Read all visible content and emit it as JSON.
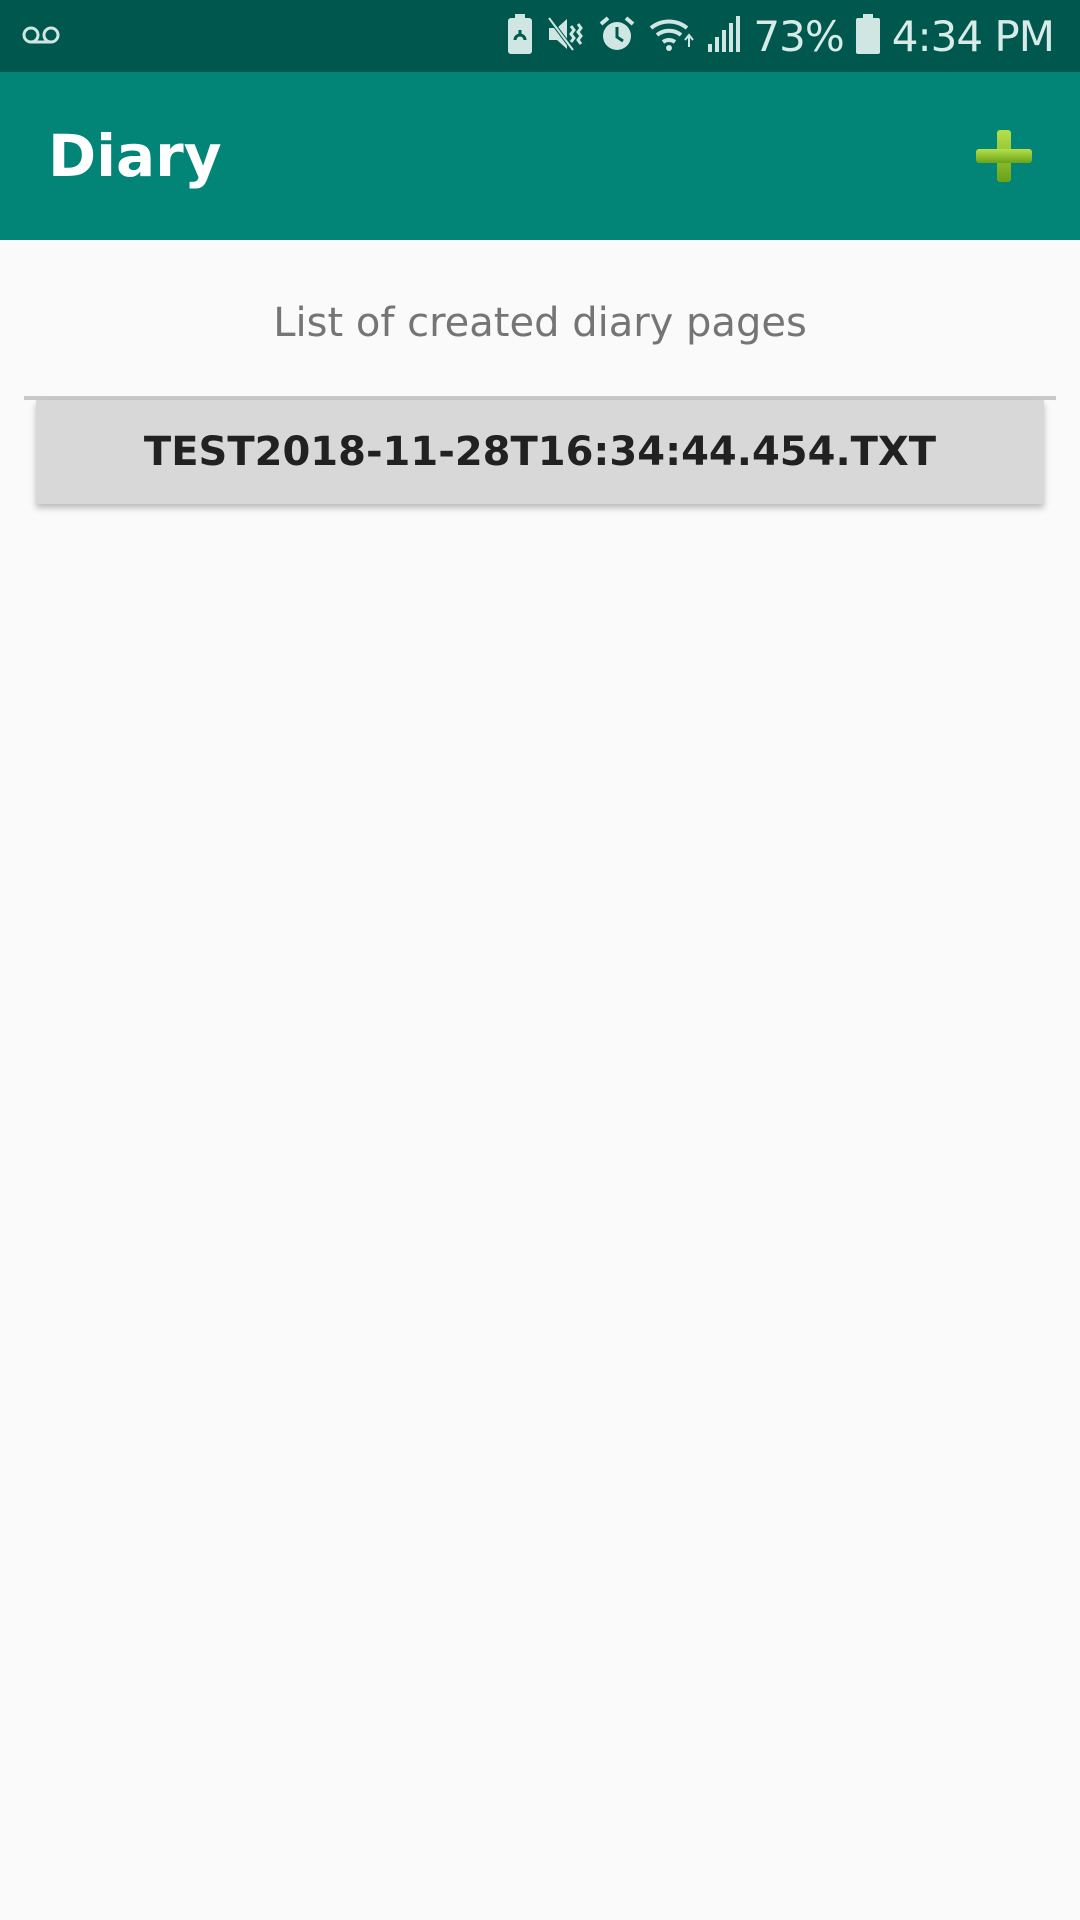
{
  "status_bar": {
    "battery_percent": "73%",
    "time": "4:34 PM",
    "icons": [
      "voicemail-icon",
      "battery-saver-icon",
      "vibrate-mute-icon",
      "alarm-icon",
      "wifi-icon",
      "signal-icon",
      "battery-icon"
    ]
  },
  "app_bar": {
    "title": "Diary",
    "add_icon": "plus-icon",
    "colors": {
      "status_bar": "#00574d",
      "app_bar": "#028576",
      "add_icon": "#8cc63f"
    }
  },
  "main": {
    "subtitle": "List of created diary pages",
    "items": [
      {
        "label": "TEST2018-11-28T16:34:44.454.TXT"
      }
    ]
  }
}
